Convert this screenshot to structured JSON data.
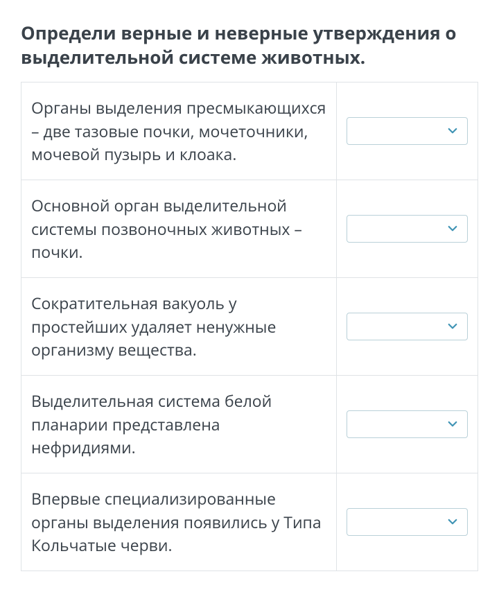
{
  "question": {
    "title": "Определи верные и неверные утверждения о выделительной системе животных."
  },
  "rows": [
    {
      "statement": "Органы выделения пресмыкающихся – две тазовые почки, мочеточники, мочевой пузырь и клоака."
    },
    {
      "statement": "Основной орган выделительной системы позвоночных животных – почки."
    },
    {
      "statement": "Сократительная вакуоль у простейших удаляет ненужные организму вещества."
    },
    {
      "statement": "Выделительная система белой планарии представлена нефридиями."
    },
    {
      "statement": "Впервые специализированные органы выделения появились у Типа Кольчатые черви."
    }
  ],
  "colors": {
    "chevron": "#4094b5"
  }
}
